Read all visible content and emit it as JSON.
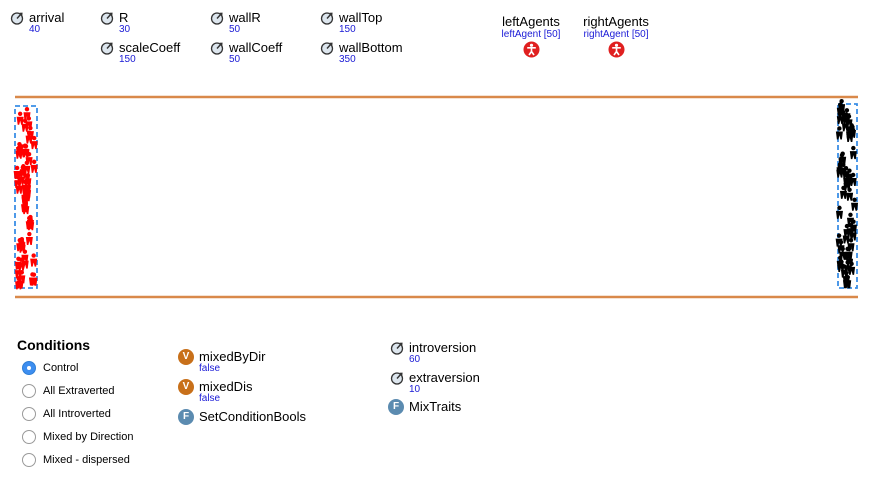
{
  "parameters": [
    {
      "name": "arrival",
      "value": "40"
    },
    {
      "name": "R",
      "value": "30"
    },
    {
      "name": "scaleCoeff",
      "value": "150"
    },
    {
      "name": "wallR",
      "value": "50"
    },
    {
      "name": "wallCoeff",
      "value": "50"
    },
    {
      "name": "wallTop",
      "value": "150"
    },
    {
      "name": "wallBottom",
      "value": "350"
    },
    {
      "name": "introversion",
      "value": "60"
    },
    {
      "name": "extraversion",
      "value": "10"
    }
  ],
  "agents": [
    {
      "name": "leftAgents",
      "value": "leftAgent [50]"
    },
    {
      "name": "rightAgents",
      "value": "rightAgent [50]"
    }
  ],
  "conditions": {
    "title": "Conditions",
    "selected": "Control",
    "options": [
      "Control",
      "All Extraverted",
      "All Introverted",
      "Mixed by Direction",
      "Mixed - dispersed"
    ]
  },
  "variables": [
    {
      "type": "V",
      "name": "mixedByDir",
      "value": "false"
    },
    {
      "type": "V",
      "name": "mixedDis",
      "value": "false"
    }
  ],
  "functions": [
    {
      "type": "F",
      "name": "SetConditionBools"
    },
    {
      "type": "F",
      "name": "MixTraits"
    }
  ],
  "colors": {
    "wall": "#d9894a",
    "left_agents": "#ff0000",
    "right_agents": "#000000",
    "group_box": "#3a8ee6",
    "value_text": "#1a1ad6",
    "agent_icon": "#e02020",
    "radio_selected": "#3d8ef0",
    "variable_icon": "#c8701a",
    "function_icon": "#5b8bb0"
  }
}
